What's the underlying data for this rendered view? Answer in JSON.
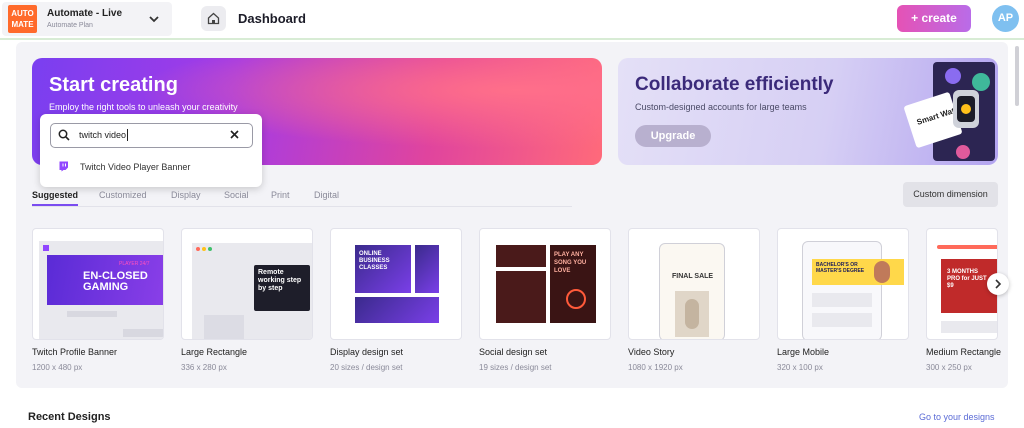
{
  "header": {
    "brand_logo": "AUTO MATE",
    "brand_name": "Automate - Live",
    "brand_plan": "Automate Plan",
    "title": "Dashboard",
    "create_label": "+ create",
    "avatar_initials": "AP"
  },
  "hero": {
    "title": "Start creating",
    "subtitle": "Employ the right tools to unleash your creativity"
  },
  "search": {
    "value": "twitch video",
    "suggestion": "Twitch Video Player Banner"
  },
  "collab": {
    "title": "Collaborate efficiently",
    "subtitle": "Custom-designed accounts for large teams",
    "upgrade_label": "Upgrade"
  },
  "tabs": [
    "Suggested",
    "Customized",
    "Display",
    "Social",
    "Print",
    "Digital"
  ],
  "custom_dimension_label": "Custom dimension",
  "designs": [
    {
      "title": "Twitch Profile Banner",
      "size": "1200 x 480 px",
      "art_text": "EN-CLOSED GAMING",
      "art_small": "PLAYER 24/7"
    },
    {
      "title": "Large Rectangle",
      "size": "336 x 280 px",
      "art_text": "Remote working step by step"
    },
    {
      "title": "Display design set",
      "size": "20 sizes / design set",
      "art_text": "ONLINE BUSINESS CLASSES"
    },
    {
      "title": "Social design set",
      "size": "19 sizes / design set",
      "art_text": "PLAY ANY SONG YOU LOVE"
    },
    {
      "title": "Video Story",
      "size": "1080 x 1920 px",
      "art_text": "FINAL SALE"
    },
    {
      "title": "Large Mobile",
      "size": "320 x 100 px",
      "art_text": "BACHELOR'S OR MASTER'S DEGREE"
    },
    {
      "title": "Medium Rectangle",
      "size": "300 x 250 px",
      "art_text": "3 MONTHS PRO for JUST $9"
    }
  ],
  "recent": {
    "title": "Recent Designs",
    "link": "Go to your designs"
  },
  "collab_art_text": "Smart Watch",
  "colors": {
    "accent": "#7a4cf0",
    "create_gradient_start": "#e552b5",
    "create_gradient_end": "#b96ce8",
    "link": "#5b6bd6"
  }
}
